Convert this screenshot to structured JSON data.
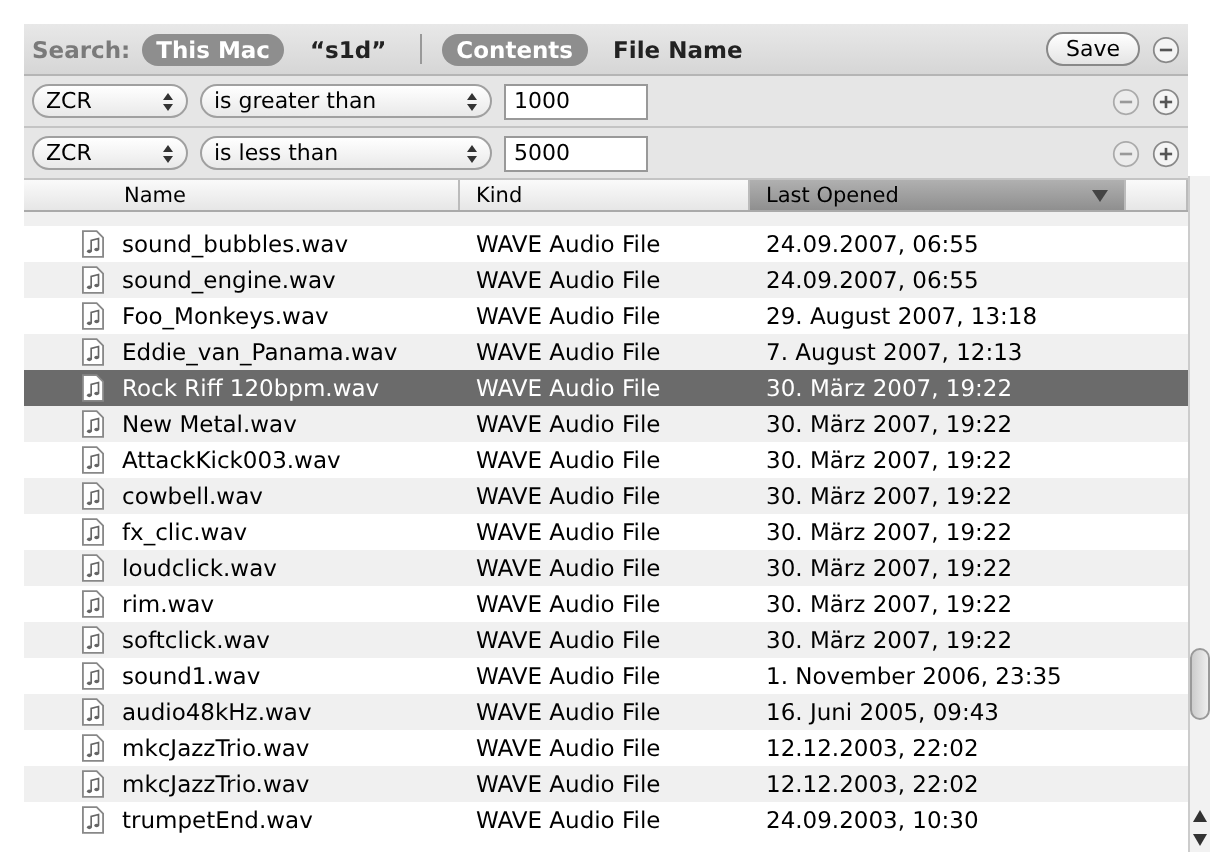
{
  "search": {
    "label": "Search:",
    "scopes": [
      {
        "label": "This Mac",
        "selected": true
      },
      {
        "label": "“s1d”",
        "selected": false
      }
    ],
    "targets": [
      {
        "label": "Contents",
        "selected": true
      },
      {
        "label": "File Name",
        "selected": false
      }
    ],
    "save": "Save"
  },
  "criteria": [
    {
      "attribute": "ZCR",
      "operator": "is greater than",
      "value": "1000"
    },
    {
      "attribute": "ZCR",
      "operator": "is less than",
      "value": "5000"
    }
  ],
  "table": {
    "columns": [
      {
        "label": "Name",
        "sorted": false
      },
      {
        "label": "Kind",
        "sorted": false
      },
      {
        "label": "Last Opened",
        "sorted": true
      }
    ],
    "rows": [
      {
        "name": "sound_bubbles.wav",
        "kind": "WAVE Audio File",
        "last_opened": "24.09.2007, 06:55",
        "selected": false
      },
      {
        "name": "sound_engine.wav",
        "kind": "WAVE Audio File",
        "last_opened": "24.09.2007, 06:55",
        "selected": false
      },
      {
        "name": "Foo_Monkeys.wav",
        "kind": "WAVE Audio File",
        "last_opened": "29. August 2007, 13:18",
        "selected": false
      },
      {
        "name": "Eddie_van_Panama.wav",
        "kind": "WAVE Audio File",
        "last_opened": "7. August 2007, 12:13",
        "selected": false
      },
      {
        "name": "Rock Riff 120bpm.wav",
        "kind": "WAVE Audio File",
        "last_opened": "30. März 2007, 19:22",
        "selected": true
      },
      {
        "name": "New Metal.wav",
        "kind": "WAVE Audio File",
        "last_opened": "30. März 2007, 19:22",
        "selected": false
      },
      {
        "name": "AttackKick003.wav",
        "kind": "WAVE Audio File",
        "last_opened": "30. März 2007, 19:22",
        "selected": false
      },
      {
        "name": "cowbell.wav",
        "kind": "WAVE Audio File",
        "last_opened": "30. März 2007, 19:22",
        "selected": false
      },
      {
        "name": "fx_clic.wav",
        "kind": "WAVE Audio File",
        "last_opened": "30. März 2007, 19:22",
        "selected": false
      },
      {
        "name": "loudclick.wav",
        "kind": "WAVE Audio File",
        "last_opened": "30. März 2007, 19:22",
        "selected": false
      },
      {
        "name": "rim.wav",
        "kind": "WAVE Audio File",
        "last_opened": "30. März 2007, 19:22",
        "selected": false
      },
      {
        "name": "softclick.wav",
        "kind": "WAVE Audio File",
        "last_opened": "30. März 2007, 19:22",
        "selected": false
      },
      {
        "name": "sound1.wav",
        "kind": "WAVE Audio File",
        "last_opened": "1. November 2006, 23:35",
        "selected": false
      },
      {
        "name": "audio48kHz.wav",
        "kind": "WAVE Audio File",
        "last_opened": "16. Juni 2005, 09:43",
        "selected": false
      },
      {
        "name": "mkcJazzTrio.wav",
        "kind": "WAVE Audio File",
        "last_opened": "12.12.2003, 22:02",
        "selected": false
      },
      {
        "name": "mkcJazzTrio.wav",
        "kind": "WAVE Audio File",
        "last_opened": "12.12.2003, 22:02",
        "selected": false
      },
      {
        "name": "trumpetEnd.wav",
        "kind": "WAVE Audio File",
        "last_opened": "24.09.2003, 10:30",
        "selected": false
      }
    ]
  }
}
